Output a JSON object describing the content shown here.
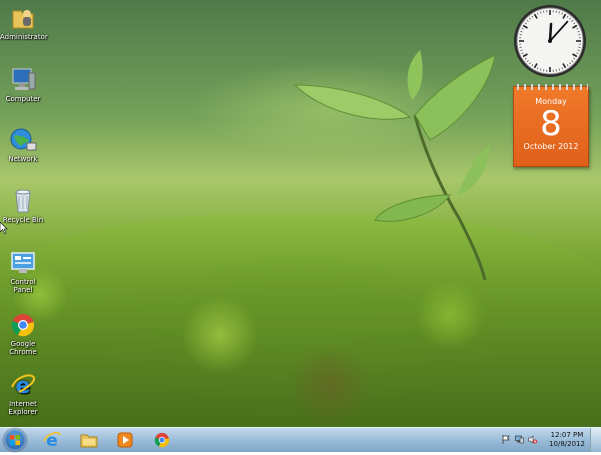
{
  "desktop_icons": [
    {
      "id": "administrator",
      "label": "Administrator",
      "icon": "folder-user-icon"
    },
    {
      "id": "computer",
      "label": "Computer",
      "icon": "computer-icon"
    },
    {
      "id": "network",
      "label": "Network",
      "icon": "network-globe-icon"
    },
    {
      "id": "recycle-bin",
      "label": "Recycle Bin",
      "icon": "recycle-bin-icon"
    },
    {
      "id": "control-panel",
      "label": "Control Panel",
      "icon": "control-panel-icon"
    },
    {
      "id": "google-chrome",
      "label": "Google Chrome",
      "icon": "chrome-icon"
    },
    {
      "id": "internet-explorer",
      "label": "Internet Explorer",
      "icon": "ie-icon"
    }
  ],
  "clock_gadget": {
    "hour": 12,
    "minute": 7
  },
  "calendar_gadget": {
    "weekday": "Monday",
    "day": "8",
    "month_year": "October 2012"
  },
  "taskbar": {
    "start_icon": "windows-start-icon",
    "pinned": [
      "ie-icon",
      "file-explorer-icon",
      "media-player-icon",
      "chrome-icon"
    ],
    "tray_icons": [
      "action-center-flag-icon",
      "network-icon",
      "volume-muted-icon"
    ],
    "time": "12:07 PM",
    "date": "10/8/2012"
  },
  "colors": {
    "calendar_orange": "#e8661f",
    "taskbar_blue": "#9cc0dd"
  }
}
